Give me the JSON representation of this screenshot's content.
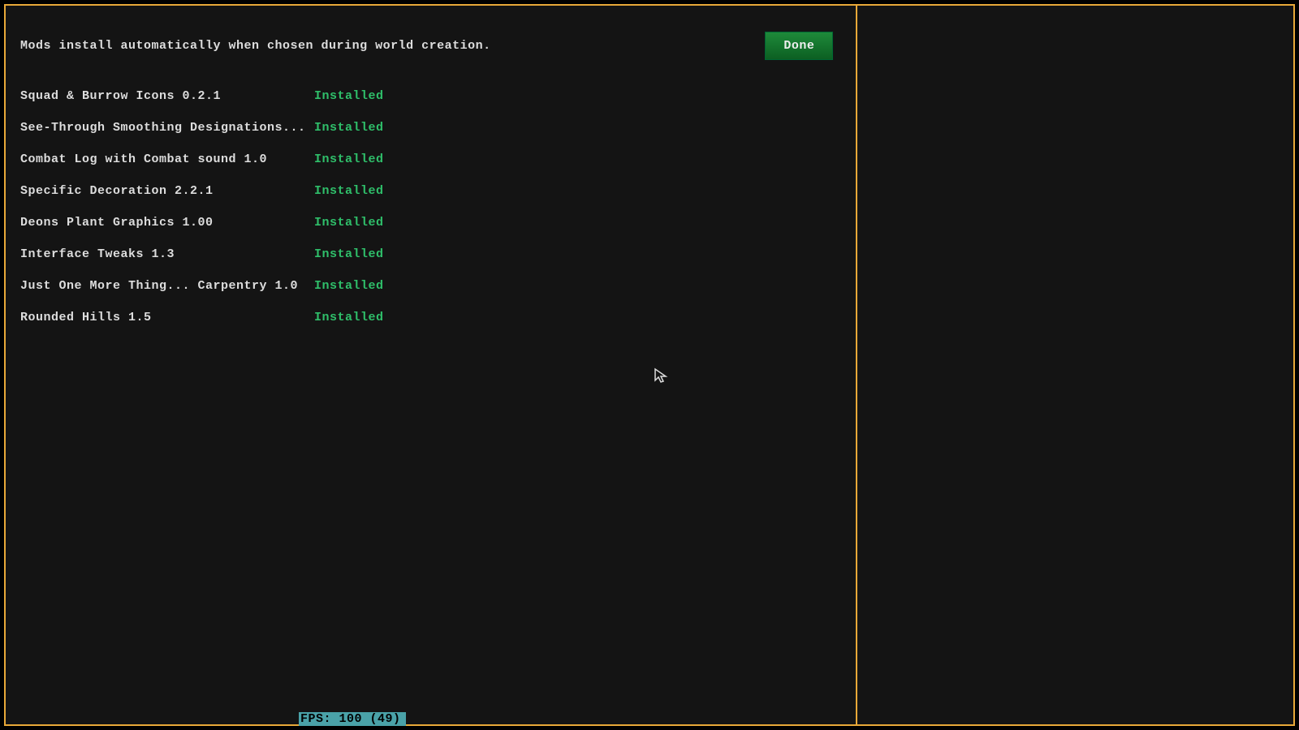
{
  "header": {
    "info_text": "Mods install automatically when chosen during world creation.",
    "done_label": "Done"
  },
  "mod_list": [
    {
      "name": "Squad & Burrow Icons 0.2.1",
      "status": "Installed"
    },
    {
      "name": "See-Through Smoothing Designations...",
      "status": "Installed"
    },
    {
      "name": "Combat Log with Combat sound 1.0",
      "status": "Installed"
    },
    {
      "name": "Specific Decoration 2.2.1",
      "status": "Installed"
    },
    {
      "name": "Deons Plant Graphics 1.00",
      "status": "Installed"
    },
    {
      "name": "Interface Tweaks 1.3",
      "status": "Installed"
    },
    {
      "name": "Just One More Thing... Carpentry 1.0",
      "status": "Installed"
    },
    {
      "name": "Rounded Hills 1.5",
      "status": "Installed"
    }
  ],
  "footer": {
    "fps_text": "FPS: 100 (49)"
  }
}
